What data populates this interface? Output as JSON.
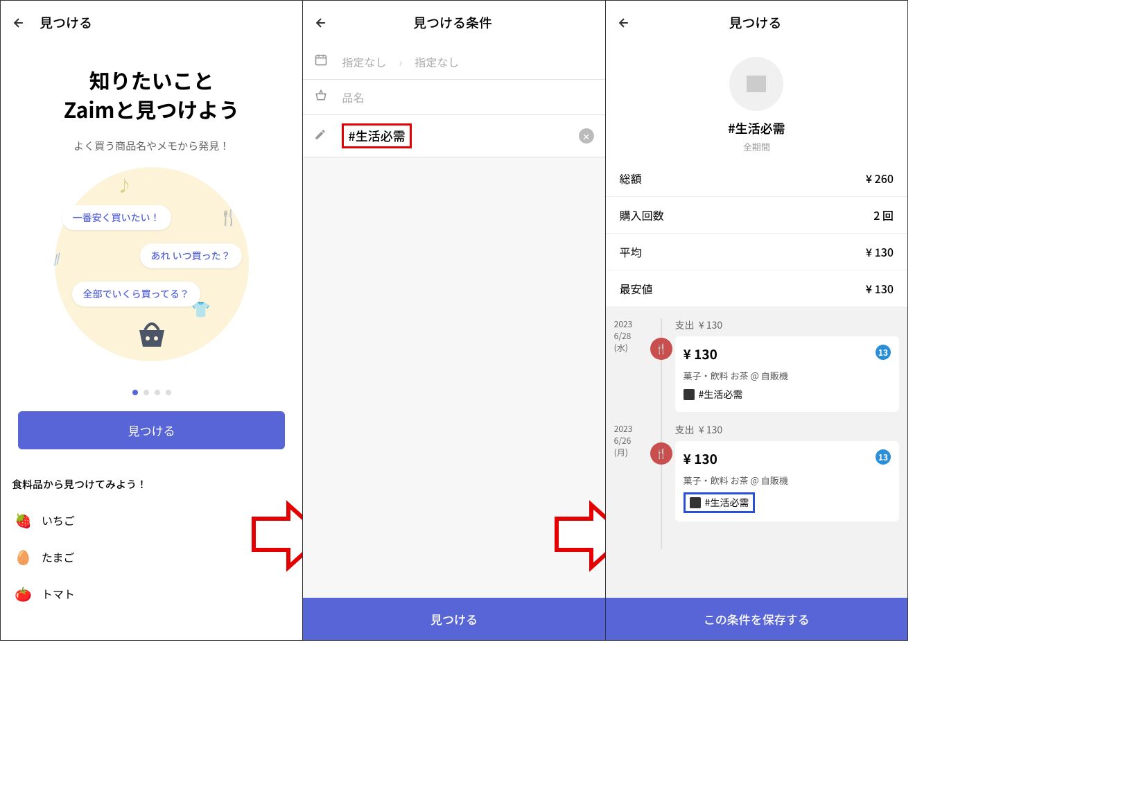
{
  "screen1": {
    "header": {
      "title": "見つける"
    },
    "hero": {
      "line1": "知りたいこと",
      "line2": "Zaimと見つけよう"
    },
    "subtitle": "よく買う商品名やメモから発見！",
    "bubbles": {
      "b1": "一番安く買いたい！",
      "b2": "あれ いつ買った？",
      "b3": "全部でいくら買ってる？"
    },
    "find_button": "見つける",
    "section_title": "食料品から見つけてみよう！",
    "suggestions": [
      {
        "emoji": "🍓",
        "label": "いちご"
      },
      {
        "emoji": "🥚",
        "label": "たまご"
      },
      {
        "emoji": "🍅",
        "label": "トマト"
      }
    ]
  },
  "screen2": {
    "header": {
      "title": "見つける条件"
    },
    "date_from": "指定なし",
    "date_to": "指定なし",
    "item_placeholder": "品名",
    "memo_value": "#生活必需",
    "find_button": "見つける"
  },
  "screen3": {
    "header": {
      "title": "見つける"
    },
    "tag": "#生活必需",
    "period": "全期間",
    "stats": {
      "total_label": "総額",
      "total_value": "¥ 260",
      "count_label": "購入回数",
      "count_value": "2 回",
      "avg_label": "平均",
      "avg_value": "¥ 130",
      "min_label": "最安値",
      "min_value": "¥ 130"
    },
    "transactions": [
      {
        "year": "2023",
        "date": "6/28",
        "dow": "(水)",
        "type": "支出",
        "type_amount": "¥ 130",
        "amount": "¥ 130",
        "badge": "13",
        "detail": "菓子・飲料 お茶 @ 自販機",
        "memo": "#生活必需",
        "memo_boxed": false
      },
      {
        "year": "2023",
        "date": "6/26",
        "dow": "(月)",
        "type": "支出",
        "type_amount": "¥ 130",
        "amount": "¥ 130",
        "badge": "13",
        "detail": "菓子・飲料 お茶 @ 自販機",
        "memo": "#生活必需",
        "memo_boxed": true
      }
    ],
    "save_button": "この条件を保存する"
  }
}
